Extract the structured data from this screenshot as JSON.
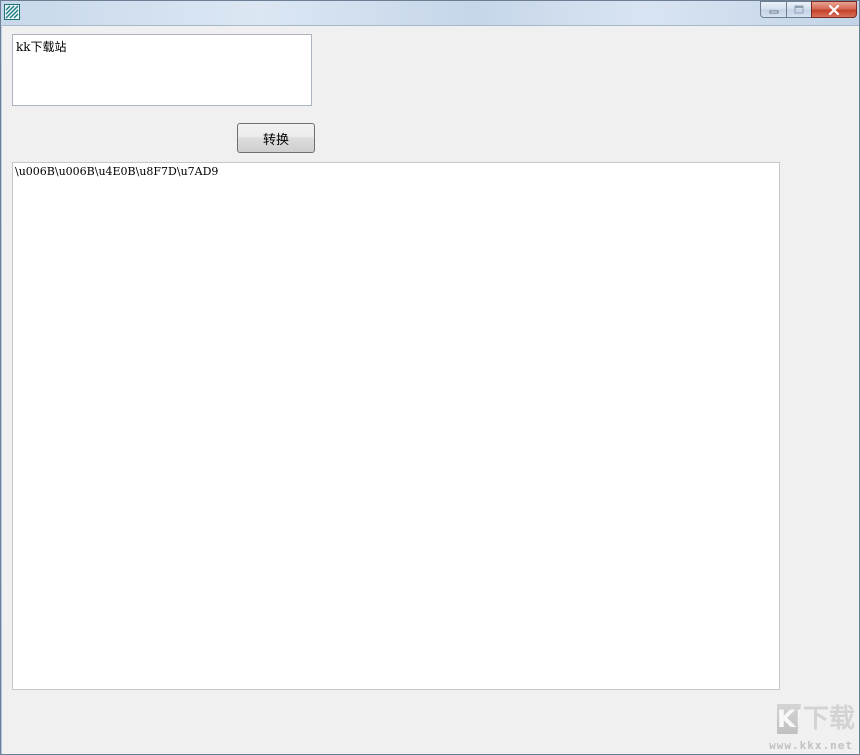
{
  "window": {
    "icon": "app-icon",
    "caption_buttons": [
      "minimize-icon",
      "maximize-icon",
      "close-icon"
    ]
  },
  "input": {
    "value": "kk下载站"
  },
  "convert_button": {
    "label": "转换"
  },
  "output": {
    "value": "\\u006B\\u006B\\u4E0B\\u8F7D\\u7AD9"
  },
  "watermark": {
    "letters": "KK",
    "chinese": "下载",
    "url": "www.kkx.net"
  }
}
